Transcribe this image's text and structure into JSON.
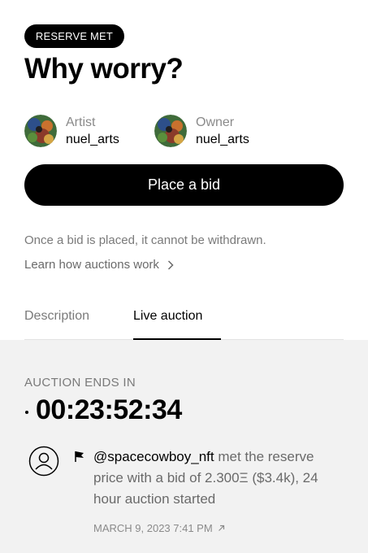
{
  "badge": "RESERVE MET",
  "title": "Why worry?",
  "artist": {
    "role": "Artist",
    "handle": "nuel_arts"
  },
  "owner": {
    "role": "Owner",
    "handle": "nuel_arts"
  },
  "bid_button": "Place a bid",
  "notice": "Once a bid is placed, it cannot be withdrawn.",
  "learn_link": "Learn how auctions work",
  "tabs": [
    {
      "label": "Description",
      "active": false
    },
    {
      "label": "Live auction",
      "active": true
    }
  ],
  "auction": {
    "ends_label": "AUCTION ENDS IN",
    "countdown": "00:23:52:34",
    "event": {
      "user": "@spacecowboy_nft",
      "message": " met the reserve price with a bid of 2.300Ξ ($3.4k), 24 hour auction started",
      "date": "MARCH 9, 2023 7:41 PM"
    }
  },
  "icons": {
    "chevron": "chevron-right-icon",
    "user": "user-circle-icon",
    "flag": "flag-icon",
    "external": "arrow-up-right-icon"
  },
  "colors": {
    "accent": "#000000",
    "muted": "#7a7a7a",
    "panel": "#f2f2f2"
  }
}
